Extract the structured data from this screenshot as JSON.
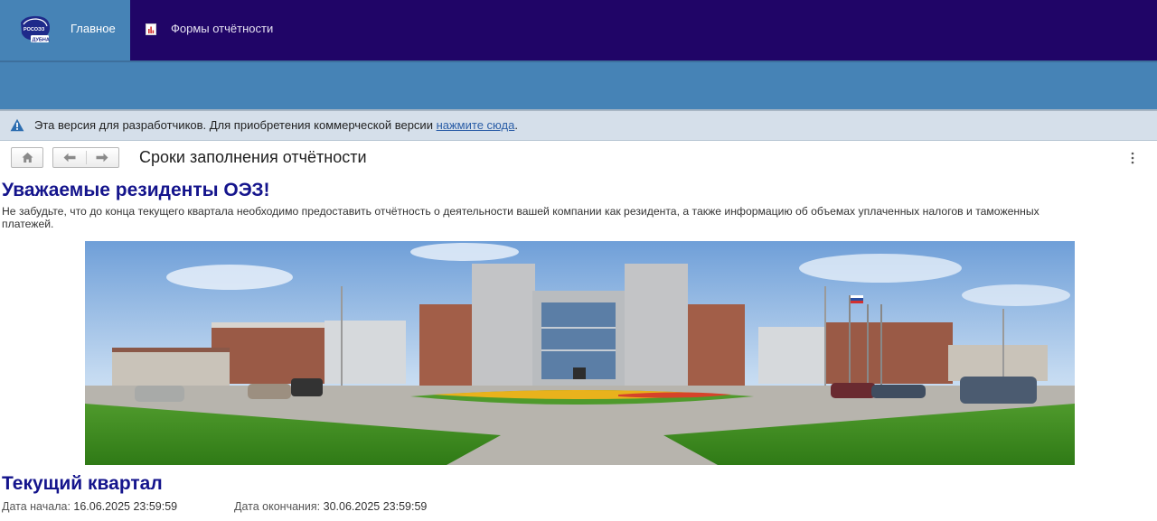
{
  "topnav": {
    "logo_text_top": "РОСОЭЗ",
    "logo_text_bottom": "ДУБНА",
    "tabs": [
      {
        "label": "Главное",
        "icon": "home-logo",
        "active": true
      },
      {
        "label": "Формы отчётности",
        "icon": "report-icon",
        "active": false
      }
    ]
  },
  "notice": {
    "icon": "warning-icon",
    "text": "Эта версия для разработчиков. Для приобретения коммерческой версии ",
    "link_text": "нажмите сюда",
    "suffix": "."
  },
  "header": {
    "title": "Сроки заполнения отчётности",
    "home_button_icon": "home-icon",
    "back_button_icon": "arrow-left-icon",
    "forward_button_icon": "arrow-right-icon",
    "menu_icon": "more-vertical-icon"
  },
  "content": {
    "greeting": "Уважаемые резиденты ОЭЗ!",
    "reminder": "Не забудьте, что до конца текущего квартала необходимо предоставить отчётность о деятельности вашей компании как резидента, а также информацию об объемах уплаченных налогов и таможенных платежей.",
    "quarter": {
      "title": "Текущий квартал",
      "start_label": "Дата начала:",
      "start_value": "16.06.2025 23:59:59",
      "end_label": "Дата окончания:",
      "end_value": "30.06.2025 23:59:59"
    }
  },
  "colors": {
    "nav_bg": "#200567",
    "accent_blue": "#4683b6",
    "heading_blue": "#14148c",
    "notice_bg": "#d5dfea",
    "link": "#2b5ea7"
  }
}
